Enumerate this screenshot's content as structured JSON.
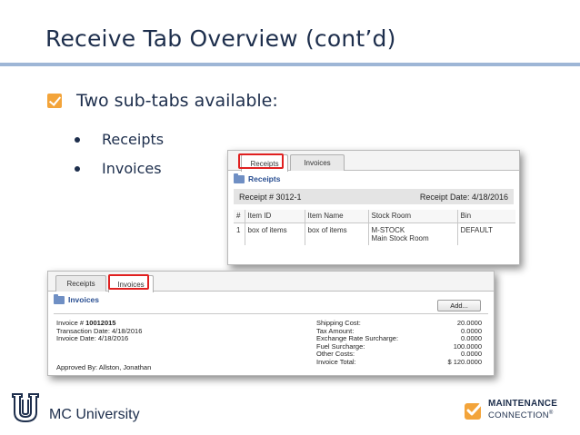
{
  "slide": {
    "title": "Receive Tab Overview (cont’d)",
    "bullet": "Two sub-tabs available:",
    "sub_bullets": [
      "Receipts",
      "Invoices"
    ]
  },
  "receipts_panel": {
    "tabs": [
      "Receipts",
      "Invoices"
    ],
    "active_tab": "Receipts",
    "section_label": "Receipts",
    "receipt_number": "Receipt # 3012-1",
    "receipt_date": "Receipt Date: 4/18/2016",
    "columns": [
      "#",
      "Item ID",
      "Item Name",
      "Stock Room",
      "Bin"
    ],
    "row": {
      "num": "1",
      "item_id": "box of items",
      "item_name": "box of items",
      "stock_room_line1": "M-STOCK",
      "stock_room_line2": "Main Stock Room",
      "bin": "DEFAULT"
    }
  },
  "invoices_panel": {
    "tabs": [
      "Receipts",
      "Invoices"
    ],
    "active_tab": "Invoices",
    "section_label": "Invoices",
    "add_button": "Add...",
    "invoice_label": "Invoice # ",
    "invoice_number": "10012015",
    "transaction_date": "Transaction Date: 4/18/2016",
    "invoice_date": "Invoice Date: 4/18/2016",
    "approved_by": "Approved By: Allston, Jonathan",
    "costs": [
      {
        "label": "Shipping Cost:",
        "value": "20.0000"
      },
      {
        "label": "Tax Amount:",
        "value": "0.0000"
      },
      {
        "label": "Exchange Rate Surcharge:",
        "value": "0.0000"
      },
      {
        "label": "Fuel Surcharge:",
        "value": "100.0000"
      },
      {
        "label": "Other Costs:",
        "value": "0.0000"
      },
      {
        "label": "Invoice Total:",
        "value": "$ 120.0000"
      }
    ]
  },
  "footer": {
    "university": "MC University",
    "brand_line1": "MAINTENANCE",
    "brand_line2": "CONNECTION",
    "brand_reg": "®"
  },
  "colors": {
    "title": "#1d2e4c",
    "rule": "#9eb6d6",
    "checkbox": "#f3a43a",
    "highlight": "#e02020",
    "section_link": "#2a4f92"
  },
  "icons": [
    "checkbox-icon",
    "folder-icon",
    "university-logo",
    "maintenance-connection-logo"
  ]
}
